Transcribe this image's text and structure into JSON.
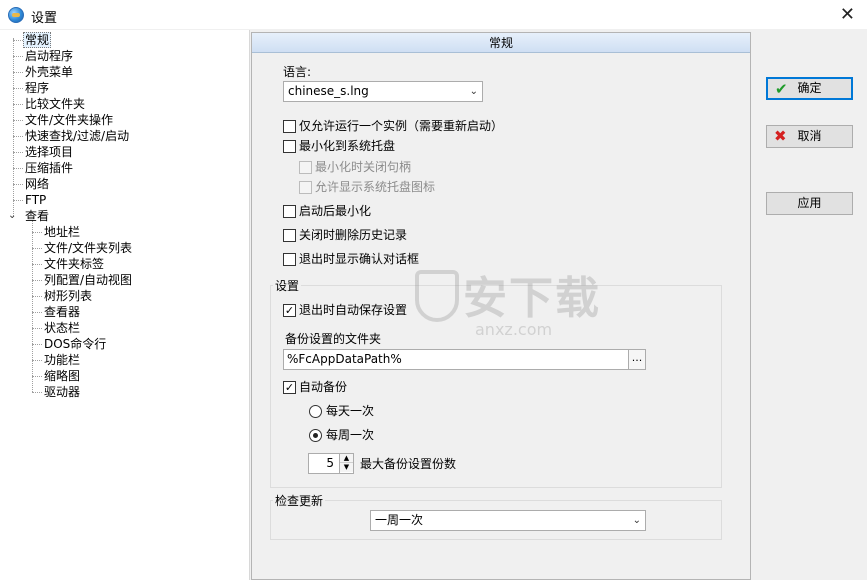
{
  "window": {
    "title": "设置"
  },
  "tree": {
    "items": [
      {
        "label": "常规",
        "selected": true
      },
      {
        "label": "启动程序"
      },
      {
        "label": "外壳菜单"
      },
      {
        "label": "程序"
      },
      {
        "label": "比较文件夹"
      },
      {
        "label": "文件/文件夹操作"
      },
      {
        "label": "快速查找/过滤/启动"
      },
      {
        "label": "选择项目"
      },
      {
        "label": "压缩插件"
      },
      {
        "label": "网络"
      },
      {
        "label": "FTP"
      },
      {
        "label": "查看",
        "expanded": true
      },
      {
        "label": "地址栏"
      },
      {
        "label": "文件/文件夹列表"
      },
      {
        "label": "文件夹标签"
      },
      {
        "label": "列配置/自动视图"
      },
      {
        "label": "树形列表"
      },
      {
        "label": "查看器"
      },
      {
        "label": "状态栏"
      },
      {
        "label": "DOS命令行"
      },
      {
        "label": "功能栏"
      },
      {
        "label": "缩略图"
      },
      {
        "label": "驱动器"
      }
    ]
  },
  "panel": {
    "header": "常规",
    "language_label": "语言:",
    "language_value": "chinese_s.lng",
    "options": [
      {
        "label": "仅允许运行一个实例（需要重新启动）",
        "checked": false,
        "enabled": true
      },
      {
        "label": "最小化到系统托盘",
        "checked": false,
        "enabled": true
      },
      {
        "label": "最小化时关闭句柄",
        "checked": false,
        "enabled": false
      },
      {
        "label": "允许显示系统托盘图标",
        "checked": false,
        "enabled": false
      },
      {
        "label": "启动后最小化",
        "checked": false,
        "enabled": true
      },
      {
        "label": "关闭时删除历史记录",
        "checked": false,
        "enabled": true
      },
      {
        "label": "退出时显示确认对话框",
        "checked": false,
        "enabled": true
      }
    ],
    "settings_group": {
      "title": "设置",
      "autosave_label": "退出时自动保存设置",
      "autosave_checked": true,
      "backup_folder_label": "备份设置的文件夹",
      "backup_folder_value": "%FcAppDataPath%",
      "browse_label": "...",
      "auto_backup_label": "自动备份",
      "auto_backup_checked": true,
      "radio_daily": "每天一次",
      "radio_weekly": "每周一次",
      "selected_frequency": "每周一次",
      "max_backups_value": "5",
      "max_backups_label": "最大备份设置份数"
    },
    "update_group": {
      "title": "检查更新",
      "value": "一周一次"
    }
  },
  "buttons": {
    "ok": "确定",
    "cancel": "取消",
    "apply": "应用"
  },
  "watermark": {
    "text": "安下载",
    "sub": "anxz.com"
  },
  "colors": {
    "accent": "#0078d7",
    "selection": "#e5f3ff",
    "ok_icon": "#1f9b2a",
    "cancel_icon": "#d42020"
  },
  "icons": {
    "ok": "check-icon",
    "cancel": "x-icon"
  }
}
